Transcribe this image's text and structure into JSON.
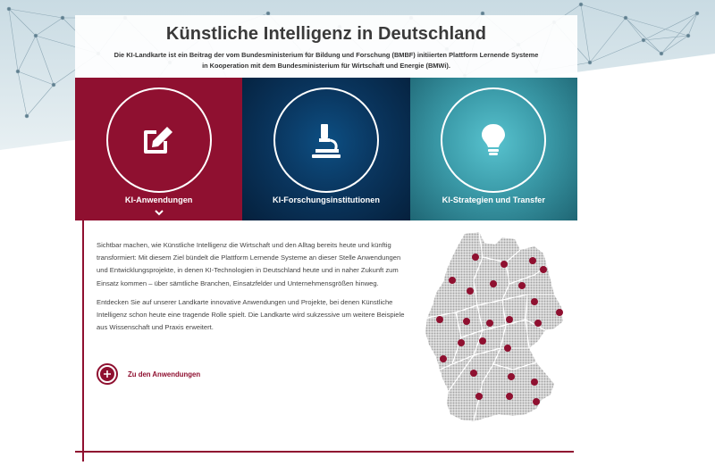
{
  "header": {
    "title": "Künstliche Intelligenz in Deutschland",
    "intro": "Die KI-Landkarte ist ein Beitrag der vom Bundesministerium für Bildung und Forschung (BMBF) initiierten Plattform Lernende Systeme in Kooperation mit dem Bundesministerium für Wirtschaft und Energie (BMWi)."
  },
  "tiles": [
    {
      "label": "KI-Anwendungen",
      "icon": "edit-icon",
      "color": "#8f1030",
      "active": true
    },
    {
      "label": "KI-Forschungsinstitutionen",
      "icon": "microscope-icon",
      "color": "#0a365f",
      "active": false
    },
    {
      "label": "KI-Strategien und Transfer",
      "icon": "lightbulb-icon",
      "color": "#3b9ba9",
      "active": false
    }
  ],
  "content": {
    "paragraphs": [
      "Sichtbar machen, wie Künstliche Intelligenz die Wirtschaft und den Alltag bereits heute und künftig transformiert: Mit diesem Ziel bündelt die Plattform Lernende Systeme an dieser Stelle Anwendungen und Entwicklungsprojekte, in denen KI-Technologien in Deutschland heute und in naher Zukunft zum Einsatz kommen – über sämtliche Branchen, Einsatzfelder und Unternehmensgrößen hinweg.",
      "Entdecken Sie auf unserer Landkarte innovative Anwendungen und Projekte, bei denen Künstliche Intelligenz schon heute eine tragende Rolle spielt. Die Landkarte wird sukzessive um weitere Beispiele aus Wissenschaft und Praxis erweitert."
    ],
    "cta_label": "Zu den Anwendungen",
    "cta_icon": "plus-circle-icon"
  },
  "colors": {
    "accent": "#8f1030",
    "navy": "#0a365f",
    "teal": "#3b9ba9",
    "map_dots": "#9a9a9a"
  },
  "map": {
    "icon": "germany-map",
    "marker_count": 25
  }
}
